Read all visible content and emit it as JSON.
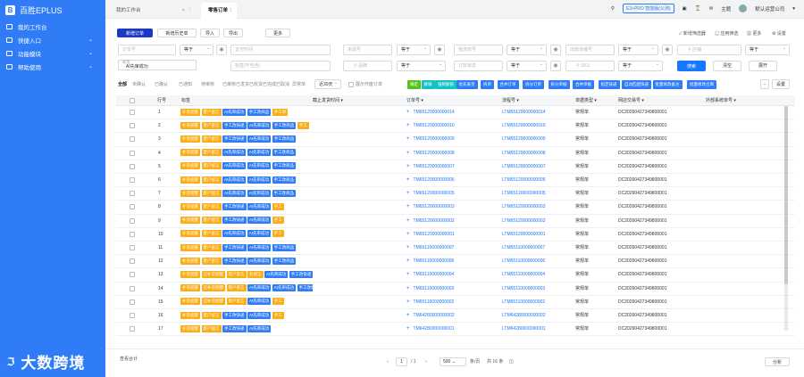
{
  "app": {
    "name": "百胜EPLUS",
    "brand": "大数跨境"
  },
  "sidebar": {
    "items": [
      {
        "label": "我的工作台",
        "has_children": false
      },
      {
        "label": "快捷入口",
        "has_children": true
      },
      {
        "label": "功能模块",
        "has_children": true
      },
      {
        "label": "帮助使用",
        "has_children": true
      }
    ]
  },
  "tabs": [
    {
      "label": "我的工作台"
    },
    {
      "label": "零售订单"
    }
  ],
  "topbar": {
    "version_badge": "E3+PRO 智能版(公测)",
    "theme_label": "主题",
    "company": "默认运营公司"
  },
  "toolbar": {
    "new_order": "新增订单",
    "history": "新增历史单",
    "import": "导入",
    "export": "导出",
    "more": "更多",
    "right": [
      "新增筛选器",
      "应用筛选",
      "更多",
      "设置"
    ]
  },
  "search": {
    "order_no_ph": "订单号",
    "equals": "等于",
    "pay_time_ph": "支付时间",
    "source_no_ph": "来源号",
    "logistics_no_ph": "物流单号",
    "outbound_no_ph": "出库单编号",
    "shop_ph": "店铺",
    "tag_label": "标签",
    "tag_value": "AI先审成功",
    "tag_hint_ph": "标签(不包含)",
    "goods_ph": "品牌",
    "order_status_ph": "订单状态",
    "sku_ph": "SKU",
    "search_btn": "搜索",
    "clear_btn": "清空",
    "expand_btn": "展开"
  },
  "filters": {
    "status": [
      "全部",
      "未确认",
      "已确认",
      "已通知",
      "待审核",
      "已审核",
      "已发货",
      "已收货",
      "已完成",
      "已取消",
      "异常单"
    ],
    "range": "近30天",
    "merge_label": "展示作废订单"
  },
  "actions": [
    {
      "label": "确定",
      "color": "#52c41a"
    },
    {
      "label": "解锁",
      "color": "#13c2c2"
    },
    {
      "label": "强制解锁",
      "color": "#13c2c2"
    },
    {
      "label": "优先发货",
      "color": "#2f7cf6"
    },
    {
      "label": "拆单",
      "color": "#2f7cf6"
    },
    {
      "label": "合并订单",
      "color": "#2f7cf6"
    },
    {
      "label": "拆分订单",
      "color": "#2f7cf6"
    },
    {
      "label": "拆分单据",
      "color": "#2f7cf6"
    },
    {
      "label": "合并单据",
      "color": "#2f7cf6"
    },
    {
      "label": "指定快递",
      "color": "#2f7cf6"
    },
    {
      "label": "自动匹配快递",
      "color": "#2f7cf6"
    },
    {
      "label": "批量修改备注",
      "color": "#2f7cf6"
    },
    {
      "label": "批量修改仓库",
      "color": "#2f7cf6"
    }
  ],
  "settings_label": "设置",
  "table": {
    "columns": [
      "行号",
      "标签",
      "截止发货时间",
      "订单号",
      "流程号",
      "单据类型",
      "网店交易号",
      "外部系统单号"
    ],
    "rows": [
      {
        "n": "1",
        "tags": [
          [
            "补货提醒",
            "o"
          ],
          [
            "客户留言",
            "o"
          ],
          [
            "AI先审成功",
            "b"
          ],
          [
            "手工改商品",
            "b"
          ],
          [
            "手工单",
            "o"
          ]
        ],
        "order": "TM65120000000014",
        "flow": "LTM65120000000014",
        "type": "常规单",
        "txn": "DC20260427349800001"
      },
      {
        "n": "2",
        "tags": [
          [
            "补货提醒",
            "o"
          ],
          [
            "客户留言",
            "o"
          ],
          [
            "手工改快递",
            "b"
          ],
          [
            "AI先审成功",
            "b"
          ],
          [
            "手工改商品",
            "b"
          ],
          [
            "手工",
            "o"
          ]
        ],
        "order": "TM65120000000010",
        "flow": "LTM65120000000010",
        "type": "常规单",
        "txn": "DC20260427349800001"
      },
      {
        "n": "3",
        "tags": [
          [
            "补货提醒",
            "o"
          ],
          [
            "客户留言",
            "o"
          ],
          [
            "手工改快递",
            "b"
          ],
          [
            "AI先审成功",
            "b"
          ],
          [
            "手工改商品",
            "b"
          ]
        ],
        "order": "TM65120000000009",
        "flow": "LTM65120000000009",
        "type": "常规单",
        "txn": "DC20260427349800001"
      },
      {
        "n": "4",
        "tags": [
          [
            "补货提醒",
            "o"
          ],
          [
            "客户留言",
            "o"
          ],
          [
            "AI先审成功",
            "b"
          ],
          [
            "AI先审成功",
            "b"
          ],
          [
            "手工改商品",
            "b"
          ]
        ],
        "order": "TM65120000000008",
        "flow": "LTM65120000000008",
        "type": "常规单",
        "txn": "DC20260427349800001"
      },
      {
        "n": "5",
        "tags": [
          [
            "补货提醒",
            "o"
          ],
          [
            "客户留言",
            "o"
          ],
          [
            "AI先审成功",
            "b"
          ],
          [
            "AI先审成功",
            "b"
          ],
          [
            "手工改商品",
            "b"
          ]
        ],
        "order": "TM65120000000007",
        "flow": "LTM65120000000007",
        "type": "常规单",
        "txn": "DC20260427349800001"
      },
      {
        "n": "6",
        "tags": [
          [
            "补货提醒",
            "o"
          ],
          [
            "客户留言",
            "o"
          ],
          [
            "AI先审成功",
            "b"
          ],
          [
            "AI先审成功",
            "b"
          ],
          [
            "手工改商品",
            "b"
          ]
        ],
        "order": "TM65120000000006",
        "flow": "LTM65120000000006",
        "type": "常规单",
        "txn": "DC20260427349800001"
      },
      {
        "n": "7",
        "tags": [
          [
            "补货提醒",
            "o"
          ],
          [
            "客户留言",
            "o"
          ],
          [
            "AI先审成功",
            "b"
          ],
          [
            "AI先审成功",
            "b"
          ],
          [
            "手工改商品",
            "b"
          ]
        ],
        "order": "TM65120000000005",
        "flow": "LTM65120000000005",
        "type": "常规单",
        "txn": "DC20260427349800001"
      },
      {
        "n": "8",
        "tags": [
          [
            "补货提醒",
            "o"
          ],
          [
            "客户留言",
            "o"
          ],
          [
            "手工改快递",
            "b"
          ],
          [
            "AI先审成功",
            "b"
          ],
          [
            "手工",
            "o"
          ]
        ],
        "order": "TM65120000000003",
        "flow": "LTM65120000000003",
        "type": "常规单",
        "txn": "DC20260427349800001"
      },
      {
        "n": "9",
        "tags": [
          [
            "补货提醒",
            "o"
          ],
          [
            "客户留言",
            "o"
          ],
          [
            "手工改快递",
            "b"
          ],
          [
            "AI先审成功",
            "b"
          ],
          [
            "手工",
            "o"
          ]
        ],
        "order": "TM65120000000002",
        "flow": "LTM65120000000002",
        "type": "常规单",
        "txn": "DC20260427349800001"
      },
      {
        "n": "10",
        "tags": [
          [
            "补货提醒",
            "o"
          ],
          [
            "客户留言",
            "o"
          ],
          [
            "AI先审成功",
            "b"
          ],
          [
            "AI先审成功",
            "b"
          ],
          [
            "手工",
            "o"
          ]
        ],
        "order": "TM65120000000001",
        "flow": "LTM65120000000001",
        "type": "常规单",
        "txn": "DC20260427349800001"
      },
      {
        "n": "11",
        "tags": [
          [
            "补货提醒",
            "o"
          ],
          [
            "客户留言",
            "o"
          ],
          [
            "手工改快递",
            "b"
          ],
          [
            "AI先审成功",
            "b"
          ],
          [
            "手工改商品",
            "b"
          ]
        ],
        "order": "TM65110000000007",
        "flow": "LTM65110000000007",
        "type": "常规单",
        "txn": "DC20260427349800001"
      },
      {
        "n": "12",
        "tags": [
          [
            "补货提醒",
            "o"
          ],
          [
            "客户留言",
            "o"
          ],
          [
            "手工改快递",
            "b"
          ],
          [
            "AI先审成功",
            "b"
          ],
          [
            "手工改商品",
            "b"
          ]
        ],
        "order": "TM65110000000006",
        "flow": "LTM65110000000006",
        "type": "常规单",
        "txn": "DC20260427349800001"
      },
      {
        "n": "13",
        "tags": [
          [
            "补货提醒",
            "o"
          ],
          [
            "已补货提醒",
            "o"
          ],
          [
            "客户留言",
            "o"
          ],
          [
            "有留言",
            "o"
          ],
          [
            "AI先审成功",
            "b"
          ],
          [
            "手工改快递",
            "b"
          ],
          [
            "手",
            "b"
          ]
        ],
        "order": "TM65110000000004",
        "flow": "LTM65110000000004",
        "type": "常规单",
        "txn": "DC20260427349800001"
      },
      {
        "n": "14",
        "tags": [
          [
            "补货提醒",
            "o"
          ],
          [
            "已补货提醒",
            "o"
          ],
          [
            "客户留言",
            "o"
          ],
          [
            "AI先审成功",
            "b"
          ],
          [
            "AI先审成功",
            "b"
          ],
          [
            "手工改商品",
            "b"
          ]
        ],
        "order": "TM65110000000003",
        "flow": "LTM65110000000003",
        "type": "常规单",
        "txn": "DC20260427349800001"
      },
      {
        "n": "15",
        "tags": [
          [
            "补货提醒",
            "o"
          ],
          [
            "已补货提醒",
            "o"
          ],
          [
            "客户留言",
            "o"
          ],
          [
            "AI先审成功",
            "b"
          ],
          [
            "手工",
            "o"
          ]
        ],
        "order": "TM65110000000002",
        "flow": "LTM65110000000002",
        "type": "常规单",
        "txn": "DC20260427349800001"
      },
      {
        "n": "16",
        "tags": [
          [
            "补货提醒",
            "o"
          ],
          [
            "客户留言",
            "o"
          ],
          [
            "手工改快递",
            "b"
          ],
          [
            "AI先审成功",
            "b"
          ],
          [
            "手工",
            "o"
          ]
        ],
        "order": "TM64280000000002",
        "flow": "LTM64280000000002",
        "type": "常规单",
        "txn": "DC20260427349800001"
      },
      {
        "n": "17",
        "tags": [
          [
            "补货提醒",
            "o"
          ],
          [
            "客户留言",
            "o"
          ],
          [
            "手工改快递",
            "b"
          ],
          [
            "AI先审成功",
            "b"
          ]
        ],
        "order": "TM64280000000001",
        "flow": "LTM64280000000001",
        "type": "常规单",
        "txn": "DC20260427349800001"
      }
    ]
  },
  "footer": {
    "summary": "查看合计",
    "page_current": "1",
    "page_total": "/ 1",
    "page_size": "500",
    "per_page": "条/页",
    "total": "共 16 条",
    "analysis_btn": "分析"
  },
  "colors": {
    "primary": "#2f7cf6",
    "orange_tag": "#faad14",
    "blue_tag": "#2f7cf6"
  }
}
